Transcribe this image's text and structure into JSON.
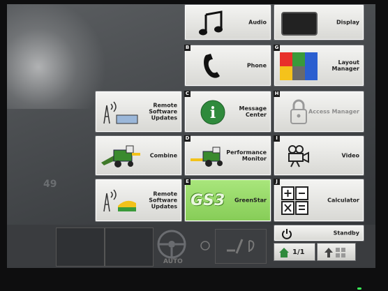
{
  "tiles": [
    {
      "id": "audio",
      "label": "Audio",
      "letter": ""
    },
    {
      "id": "display",
      "label": "Display",
      "letter": ""
    },
    {
      "id": "phone",
      "label": "Phone",
      "letter": "B"
    },
    {
      "id": "layout",
      "label": "Layout\nManager",
      "letter": "G"
    },
    {
      "id": "remote1",
      "label": "Remote\nSoftware\nUpdates",
      "letter": ""
    },
    {
      "id": "message",
      "label": "Message\nCenter",
      "letter": "C"
    },
    {
      "id": "access",
      "label": "Access Manager",
      "letter": "H"
    },
    {
      "id": "combine",
      "label": "Combine",
      "letter": ""
    },
    {
      "id": "performance",
      "label": "Performance\nMonitor",
      "letter": "D"
    },
    {
      "id": "video",
      "label": "Video",
      "letter": "I"
    },
    {
      "id": "remote2",
      "label": "Remote\nSoftware\nUpdates",
      "letter": ""
    },
    {
      "id": "greenstar",
      "label": "GreenStar",
      "letter": "E"
    },
    {
      "id": "calculator",
      "label": "Calculator",
      "letter": "J"
    },
    {
      "id": "standby",
      "label": "Standby",
      "letter": ""
    }
  ],
  "greenstar_badge": "GS3",
  "background_number": "49",
  "auto_label": "AUTO",
  "page_indicator": "1/1",
  "colors": {
    "accent_green": "#86cc57",
    "tile_bg": "#e6e6e3",
    "screen_bg": "#4a4d50"
  }
}
